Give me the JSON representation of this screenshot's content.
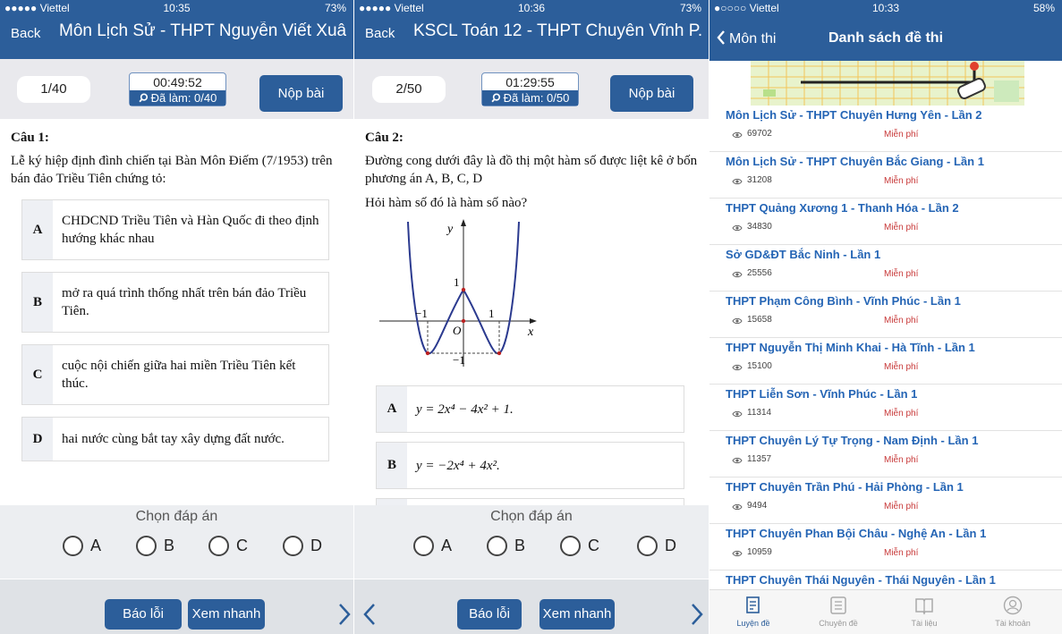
{
  "phone1": {
    "status": {
      "carrier": "●●●●● Viettel",
      "time": "10:35",
      "battery": "73%"
    },
    "back": "Back",
    "title": "Môn Lịch Sử - THPT Nguyễn Viết Xuâ...",
    "counter": "1/40",
    "timer": "00:49:52",
    "done": "Đã làm: 0/40",
    "submit": "Nộp bài",
    "q_label": "Câu 1:",
    "q_text": "Lễ ký hiệp định đình chiến tại Bàn Môn Điếm (7/1953) trên bán đảo Triều Tiên chứng tỏ:",
    "options": [
      {
        "letter": "A",
        "text": "CHDCND Triều Tiên và Hàn Quốc đi theo định hướng khác nhau"
      },
      {
        "letter": "B",
        "text": "mở ra quá trình thống nhất trên bán đảo Triều Tiên."
      },
      {
        "letter": "C",
        "text": "cuộc nội chiến giữa hai miền Triều Tiên kết thúc."
      },
      {
        "letter": "D",
        "text": "hai nước cùng bắt tay xây dựng đất nước."
      }
    ],
    "choose": "Chọn đáp án",
    "radio": [
      "A",
      "B",
      "C",
      "D"
    ],
    "report": "Báo lỗi",
    "quick": "Xem nhanh"
  },
  "phone2": {
    "status": {
      "carrier": "●●●●● Viettel",
      "time": "10:36",
      "battery": "73%"
    },
    "back": "Back",
    "title": "KSCL Toán 12 - THPT Chuyên Vĩnh P...",
    "counter": "2/50",
    "timer": "01:29:55",
    "done": "Đã làm: 0/50",
    "submit": "Nộp bài",
    "q_label": "Câu 2:",
    "q_text": "Đường cong dưới đây là đồ thị một hàm số được liệt kê ở bốn phương án A, B, C, D",
    "q_ask": "Hỏi hàm số đó là hàm số nào?",
    "graph": {
      "y": "y",
      "x": "x",
      "o": "O",
      "one": "1",
      "neg_one": "−1",
      "left_one": "−1",
      "right_one": "1"
    },
    "options": [
      {
        "letter": "A",
        "text": "y = 2x⁴ − 4x² + 1."
      },
      {
        "letter": "B",
        "text": "y = −2x⁴ + 4x²."
      }
    ],
    "choose": "Chọn đáp án",
    "radio": [
      "A",
      "B",
      "C",
      "D"
    ],
    "report": "Báo lỗi",
    "quick": "Xem nhanh"
  },
  "phone3": {
    "status": {
      "carrier": "●○○○○ Viettel",
      "time": "10:33",
      "battery": "58%"
    },
    "back": "Môn thi",
    "title": "Danh sách đề thi",
    "exams": [
      {
        "name": "Môn Lịch Sử - THPT Chuyên Hưng Yên - Lần 2",
        "views": "69702",
        "price": "Miễn phí"
      },
      {
        "name": "Môn Lịch Sử - THPT Chuyên Bắc Giang - Lần 1",
        "views": "31208",
        "price": "Miễn phí"
      },
      {
        "name": "THPT Quảng Xương 1 - Thanh Hóa - Lần 2",
        "views": "34830",
        "price": "Miễn phí"
      },
      {
        "name": "Sở GD&ĐT Bắc Ninh - Lần 1",
        "views": "25556",
        "price": "Miễn phí"
      },
      {
        "name": "THPT Phạm Công Bình - Vĩnh Phúc - Lần 1",
        "views": "15658",
        "price": "Miễn phí"
      },
      {
        "name": "THPT Nguyễn Thị Minh Khai - Hà Tĩnh - Lần 1",
        "views": "15100",
        "price": "Miễn phí"
      },
      {
        "name": "THPT Liễn Sơn - Vĩnh Phúc - Lần 1",
        "views": "11314",
        "price": "Miễn phí"
      },
      {
        "name": "THPT Chuyên Lý Tự Trọng - Nam Định - Lần 1",
        "views": "11357",
        "price": "Miễn phí"
      },
      {
        "name": "THPT Chuyên Trần Phú - Hải Phòng - Lần 1",
        "views": "9494",
        "price": "Miễn phí"
      },
      {
        "name": "THPT Chuyên Phan Bội Châu - Nghệ An - Lần 1",
        "views": "10959",
        "price": "Miễn phí"
      },
      {
        "name": "THPT Chuyên Thái Nguyên - Thái Nguyên - Lần 1",
        "views": "",
        "price": ""
      }
    ],
    "tabs": [
      "Luyện đề",
      "Chuyên đề",
      "Tài liệu",
      "Tài khoản"
    ]
  },
  "colors": {
    "brand": "#2c5e9a",
    "link": "#2565b5",
    "free": "#c83a3a",
    "curve": "#2b3a8f"
  },
  "icons": [
    "search-icon",
    "eye-icon",
    "chevron-left-icon",
    "chevron-right-icon",
    "exam-tab-icon",
    "topic-tab-icon",
    "book-tab-icon",
    "account-tab-icon"
  ]
}
